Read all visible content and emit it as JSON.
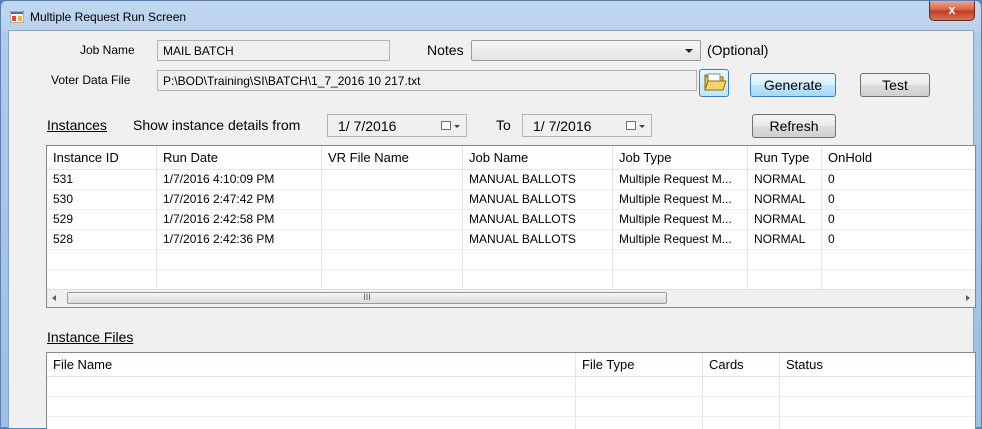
{
  "window": {
    "title": "Multiple Request Run Screen",
    "close_glyph": "x"
  },
  "form": {
    "job_name_label": "Job Name",
    "job_name_value": "MAIL BATCH",
    "notes_label": "Notes",
    "notes_value": "",
    "optional_label": "(Optional)",
    "voter_file_label": "Voter Data File",
    "voter_file_value": "P:\\BOD\\Training\\SI\\BATCH\\1_7_2016 10 217.txt",
    "generate_label": "Generate",
    "test_label": "Test"
  },
  "instances": {
    "section_label": "Instances",
    "from_label": "Show instance details from",
    "from_date": "1/ 7/2016",
    "to_label": "To",
    "to_date": "1/ 7/2016",
    "refresh_label": "Refresh",
    "columns": [
      "Instance ID",
      "Run Date",
      "VR File Name",
      "Job Name",
      "Job Type",
      "Run Type",
      "OnHold"
    ],
    "rows": [
      [
        "531",
        "1/7/2016 4:10:09 PM",
        "",
        "MANUAL BALLOTS",
        "Multiple Request M...",
        "NORMAL",
        "0"
      ],
      [
        "530",
        "1/7/2016 2:47:42 PM",
        "",
        "MANUAL BALLOTS",
        "Multiple Request M...",
        "NORMAL",
        "0"
      ],
      [
        "529",
        "1/7/2016 2:42:58 PM",
        "",
        "MANUAL BALLOTS",
        "Multiple Request M...",
        "NORMAL",
        "0"
      ],
      [
        "528",
        "1/7/2016 2:42:36 PM",
        "",
        "MANUAL BALLOTS",
        "Multiple Request M...",
        "NORMAL",
        "0"
      ]
    ],
    "scroll_grip": "III"
  },
  "files": {
    "section_label": "Instance Files",
    "columns": [
      "File Name",
      "File Type",
      "Cards",
      "Status"
    ]
  },
  "colors": {
    "title_bar": "#b9d1ec",
    "close_button": "#c23a1f",
    "client_bg": "#f0f0f0",
    "focus_button": "#bee6fd"
  }
}
